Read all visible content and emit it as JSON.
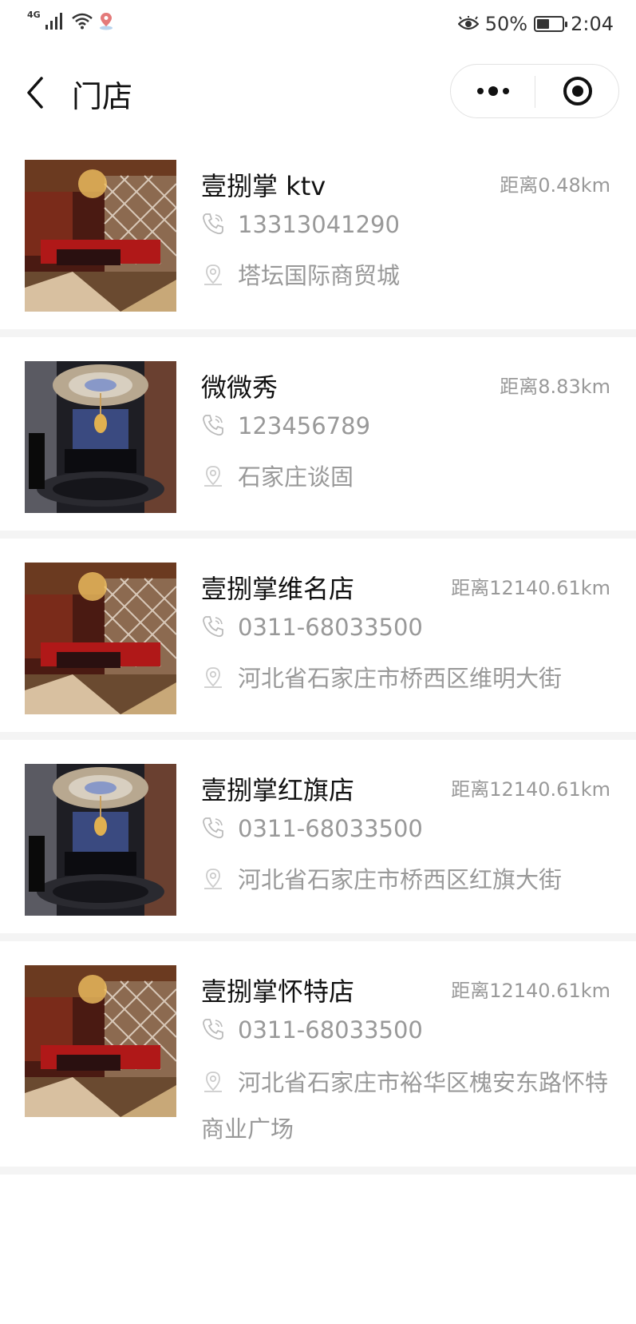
{
  "status_bar": {
    "network": "4G",
    "battery_percent_text": "50%",
    "battery_level": 0.5,
    "time": "2:04"
  },
  "nav": {
    "title": "门店"
  },
  "stores": [
    {
      "name": "壹捌掌 ktv",
      "distance": "距离0.48km",
      "phone": "13313041290",
      "address": "塔坛国际商贸城",
      "image": "red-ktv-room"
    },
    {
      "name": "微微秀",
      "distance": "距离8.83km",
      "phone": "123456789",
      "address": "石家庄谈固",
      "image": "dark-ktv-room"
    },
    {
      "name": "壹捌掌维名店",
      "distance": "距离12140.61km",
      "phone": "0311-68033500",
      "address": "河北省石家庄市桥西区维明大街",
      "image": "red-ktv-room"
    },
    {
      "name": "壹捌掌红旗店",
      "distance": "距离12140.61km",
      "phone": "0311-68033500",
      "address": "河北省石家庄市桥西区红旗大街",
      "image": "dark-ktv-room"
    },
    {
      "name": "壹捌掌怀特店",
      "distance": "距离12140.61km",
      "phone": "0311-68033500",
      "address": "河北省石家庄市裕华区槐安东路怀特商业广场",
      "image": "red-ktv-room"
    }
  ],
  "icons": {
    "phone": "phone-icon",
    "location": "location-pin-icon",
    "back": "chevron-left-icon",
    "more": "more-dots-icon",
    "close": "target-close-icon"
  },
  "colors": {
    "text_primary": "#111111",
    "text_secondary": "#999999",
    "divider": "#f4f4f4",
    "icon_light": "#cccccc"
  }
}
